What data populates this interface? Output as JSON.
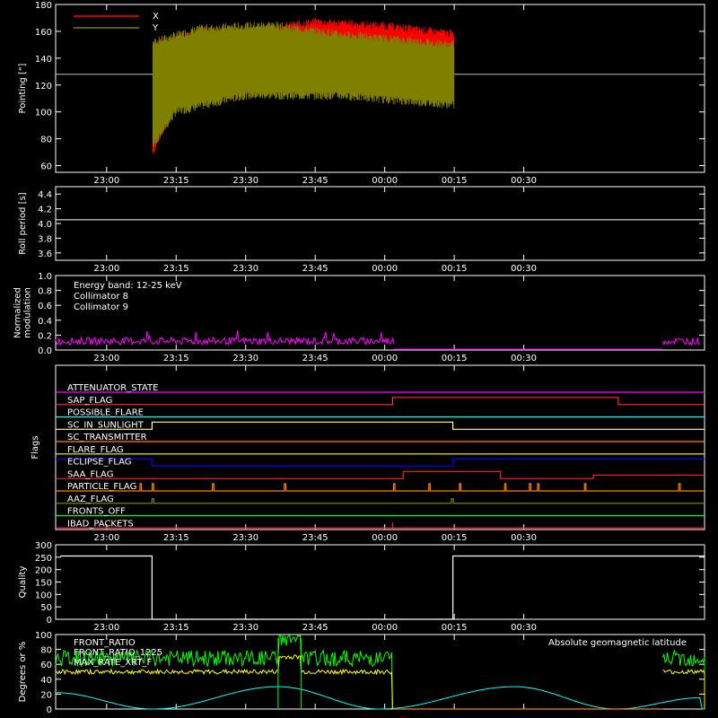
{
  "colors": {
    "bg": "#000000",
    "axis": "#ffffff",
    "x_pointing": "#ff0000",
    "y_pointing": "#808000",
    "roll": "#ffffff",
    "coll8": "#00ffff",
    "coll9": "#ff00ff",
    "quality": "#ffffff",
    "front_ratio": "#ffff00",
    "front_ratio_1225": "#00ff00",
    "geomag": "#00ffff"
  },
  "time_ticks": [
    "23:00",
    "23:15",
    "23:30",
    "23:45",
    "00:00",
    "00:15",
    "00:30"
  ],
  "chart_data": [
    {
      "id": "pointing",
      "type": "line",
      "ylabel": "Pointing [\"]",
      "ylim": [
        55,
        180
      ],
      "yticks": [
        "60",
        "80",
        "100",
        "120",
        "140",
        "160",
        "180"
      ],
      "legend": [
        {
          "name": "X",
          "color": "#ff0000"
        },
        {
          "name": "Y",
          "color": "#808000"
        }
      ],
      "x_range_minutes": [
        -10,
        75
      ],
      "series": [
        {
          "name": "X",
          "description_points": [
            [
              10,
              70
            ],
            [
              15,
              110
            ],
            [
              25,
              118
            ],
            [
              40,
              122
            ],
            [
              55,
              126
            ],
            [
              75,
              128
            ]
          ],
          "upper": [
            [
              10,
              150
            ],
            [
              20,
              160
            ],
            [
              35,
              162
            ],
            [
              45,
              167
            ],
            [
              60,
              164
            ],
            [
              75,
              158
            ]
          ]
        },
        {
          "name": "Y",
          "description_points": [
            [
              10,
              75
            ],
            [
              15,
              100
            ],
            [
              30,
              112
            ],
            [
              50,
              112
            ],
            [
              75,
              105
            ]
          ],
          "upper": [
            [
              10,
              152
            ],
            [
              20,
              162
            ],
            [
              35,
              165
            ],
            [
              50,
              158
            ],
            [
              75,
              150
            ]
          ]
        }
      ],
      "reference_line": 128
    },
    {
      "id": "roll",
      "type": "line",
      "ylabel": "Roll period [s]",
      "ylim": [
        3.5,
        4.5
      ],
      "yticks": [
        "3.6",
        "3.8",
        "4.0",
        "4.2",
        "4.4"
      ],
      "value": 4.05
    },
    {
      "id": "modulation",
      "type": "line",
      "ylabel": "Normalized modulation",
      "ylim": [
        0,
        1.0
      ],
      "yticks": [
        "0.0",
        "0.2",
        "0.4",
        "0.6",
        "0.8",
        "1.0"
      ],
      "annotations": [
        "Energy band: 12-25 keV",
        "Collimator 8",
        "Collimator 9"
      ],
      "level": 0.12,
      "active_ranges_minutes": [
        [
          -11,
          62
        ],
        [
          120,
          128
        ]
      ]
    },
    {
      "id": "flags",
      "type": "table",
      "ylabel": "Flags",
      "flags": [
        {
          "label": "ATTENUATOR_STATE",
          "color": "#ff00ff",
          "segments": [
            [
              0,
              0
            ]
          ]
        },
        {
          "label": "SAP_FLAG",
          "color": "#ff3030",
          "segments": [
            [
              0,
              0
            ],
            [
              61.7,
              1
            ],
            [
              110.4,
              0
            ]
          ]
        },
        {
          "label": "POSSIBLE_FLARE",
          "color": "#00ffff",
          "segments": [
            [
              0,
              0
            ]
          ]
        },
        {
          "label": "SC_IN_SUNLIGHT",
          "color": "#ffff80",
          "segments": [
            [
              0,
              0
            ],
            [
              9.8,
              1
            ],
            [
              74.7,
              0
            ]
          ]
        },
        {
          "label": "SC_TRANSMITTER",
          "color": "#ff8000",
          "segments": [
            [
              0,
              0
            ]
          ]
        },
        {
          "label": "FLARE_FLAG",
          "color": "#ffff00",
          "segments": [
            [
              0,
              0
            ]
          ]
        },
        {
          "label": "ECLIPSE_FLAG",
          "color": "#0000ff",
          "segments": [
            [
              0,
              1
            ],
            [
              9.8,
              0
            ],
            [
              74.7,
              1
            ]
          ]
        },
        {
          "label": "SAA_FLAG",
          "color": "#ff2020",
          "segments": [
            [
              0,
              0
            ],
            [
              64,
              1
            ],
            [
              85,
              0
            ],
            [
              105,
              0.5
            ]
          ]
        },
        {
          "label": "PARTICLE_FLAG",
          "color": "#ff8000",
          "segments": [
            [
              0,
              0
            ]
          ]
        },
        {
          "label": "AAZ_FLAG",
          "color": "#808000",
          "segments": [
            [
              0,
              0
            ]
          ]
        },
        {
          "label": "FRONTS_OFF",
          "color": "#00ff00",
          "segments": [
            [
              0,
              0
            ]
          ]
        },
        {
          "label": "IBAD_PACKETS",
          "color": "#ff2020",
          "segments": [
            [
              0,
              0
            ]
          ]
        }
      ]
    },
    {
      "id": "quality",
      "type": "line",
      "ylabel": "Quality",
      "ylim": [
        0,
        300
      ],
      "yticks": [
        "0",
        "50",
        "100",
        "150",
        "200",
        "250",
        "300"
      ],
      "points": [
        [
          -10,
          255
        ],
        [
          9.8,
          255
        ],
        [
          9.8,
          0
        ],
        [
          74.7,
          0
        ],
        [
          74.7,
          255
        ],
        [
          130,
          255
        ]
      ]
    },
    {
      "id": "ratios",
      "type": "line",
      "ylabel": "Degrees or %",
      "ylim": [
        0,
        100
      ],
      "yticks": [
        "0",
        "20",
        "40",
        "60",
        "80",
        "100"
      ],
      "legend": [
        {
          "name": "FRONT_RATIO",
          "color": "#ffff00"
        },
        {
          "name": "FRONT_RATIO_1225",
          "color": "#00ff00"
        },
        {
          "name": "MAX_RATE_XRT_F",
          "color": "#ffff00"
        }
      ],
      "right_label": "Absolute geomagnetic latitude",
      "front_ratio_level": 50,
      "front_ratio_1225_level": 68,
      "geomag_points": [
        [
          -11,
          22
        ],
        [
          10,
          0
        ],
        [
          37,
          30
        ],
        [
          59,
          0
        ],
        [
          88,
          30
        ],
        [
          110,
          0
        ],
        [
          128,
          15
        ]
      ]
    }
  ]
}
